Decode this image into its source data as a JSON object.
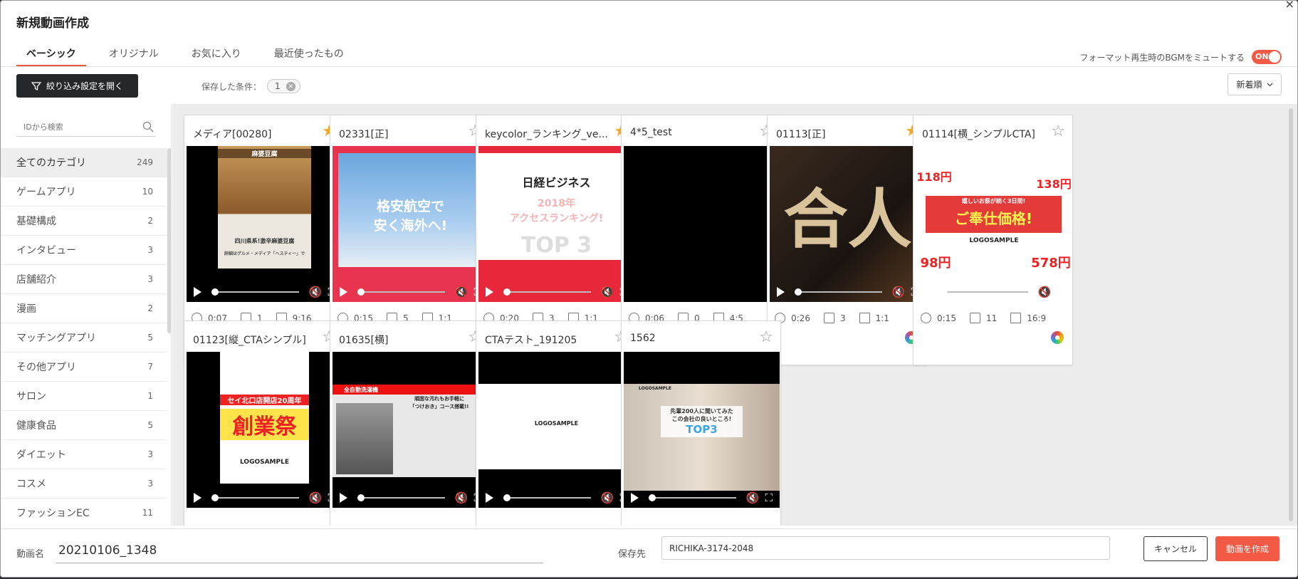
{
  "dialog": {
    "title": "新規動画作成",
    "close_icon": "×"
  },
  "tabs": [
    {
      "label": "ベーシック",
      "active": true
    },
    {
      "label": "オリジナル",
      "active": false
    },
    {
      "label": "お気に入り",
      "active": false
    },
    {
      "label": "最近使ったもの",
      "active": false
    }
  ],
  "bgm": {
    "label": "フォーマット再生時のBGMをミュートする",
    "toggle": "ON"
  },
  "toolbar": {
    "filter_label": "絞り込み設定を開く",
    "saved_label": "保存した条件：",
    "saved_chip": "1",
    "sort_label": "新着順"
  },
  "sidebar": {
    "search_placeholder": "IDから検索",
    "categories": [
      {
        "label": "全てのカテゴリ",
        "count": "249"
      },
      {
        "label": "ゲームアプリ",
        "count": "10"
      },
      {
        "label": "基礎構成",
        "count": "2"
      },
      {
        "label": "インタビュー",
        "count": "3"
      },
      {
        "label": "店舗紹介",
        "count": "3"
      },
      {
        "label": "漫画",
        "count": "2"
      },
      {
        "label": "マッチングアプリ",
        "count": "5"
      },
      {
        "label": "その他アプリ",
        "count": "7"
      },
      {
        "label": "サロン",
        "count": "1"
      },
      {
        "label": "健康食品",
        "count": "5"
      },
      {
        "label": "ダイエット",
        "count": "3"
      },
      {
        "label": "コスメ",
        "count": "3"
      },
      {
        "label": "ファッションEC",
        "count": "11"
      }
    ]
  },
  "cards": [
    {
      "name": "メディア[00280]",
      "starred": true,
      "duration": "0:07",
      "images": "1",
      "ratio": "9:16",
      "color_wheel": false,
      "thumb_text": [
        "麻婆豆腐",
        "四川県系!激辛麻婆豆腐",
        "詳細はグルメ・メディア「ヘスティー」で"
      ]
    },
    {
      "name": "02331[正]",
      "starred": false,
      "duration": "0:15",
      "images": "5",
      "ratio": "1:1",
      "color_wheel": true,
      "thumb_text": [
        "格安航空で",
        "安く海外へ!"
      ]
    },
    {
      "name": "keycolor_ランキング_ve...",
      "starred": true,
      "duration": "0:20",
      "images": "3",
      "ratio": "1:1",
      "color_wheel": true,
      "thumb_text": [
        "日経ビジネス",
        "2018年",
        "アクセスランキング!",
        "TOP 3"
      ]
    },
    {
      "name": "4*5_test",
      "starred": false,
      "duration": "0:06",
      "images": "0",
      "ratio": "4:5",
      "color_wheel": false,
      "thumb_text": []
    },
    {
      "name": "01113[正]",
      "starred": true,
      "duration": "0:26",
      "images": "3",
      "ratio": "1:1",
      "color_wheel": true,
      "thumb_text": [
        "合人"
      ]
    },
    {
      "name": "01114[横_シンプルCTA]",
      "starred": false,
      "duration": "0:15",
      "images": "11",
      "ratio": "16:9",
      "color_wheel": true,
      "thumb_text": [
        "嬉しいお祭が続く3日間!",
        "ご奉仕価格!",
        "LOGOSAMPLE",
        "138円",
        "578円",
        "98円",
        "118円"
      ]
    },
    {
      "name": "01123[縦_CTAシンプル]",
      "starred": false,
      "thumb_text": [
        "セイ北口店開店20周年",
        "創業祭",
        "LOGOSAMPLE"
      ]
    },
    {
      "name": "01635[横]",
      "starred": false,
      "thumb_text": [
        "全自動洗濯機",
        "頑固な汚れもお手軽に",
        "「つけおき」コース搭載!!"
      ]
    },
    {
      "name": "CTAテスト_191205",
      "starred": false,
      "thumb_text": [
        "LOGOSAMPLE"
      ]
    },
    {
      "name": "1562",
      "starred": false,
      "thumb_text": [
        "LOGOSAMPLE",
        "先輩200人に聞いてみた",
        "この会社の良いところ!",
        "TOP3"
      ]
    }
  ],
  "footer": {
    "name_label": "動画名",
    "name_value": "20210106_1348",
    "dest_label": "保存先",
    "dest_value": "RICHIKA-3174-2048",
    "cancel_label": "キャンセル",
    "create_label": "動画を作成"
  }
}
